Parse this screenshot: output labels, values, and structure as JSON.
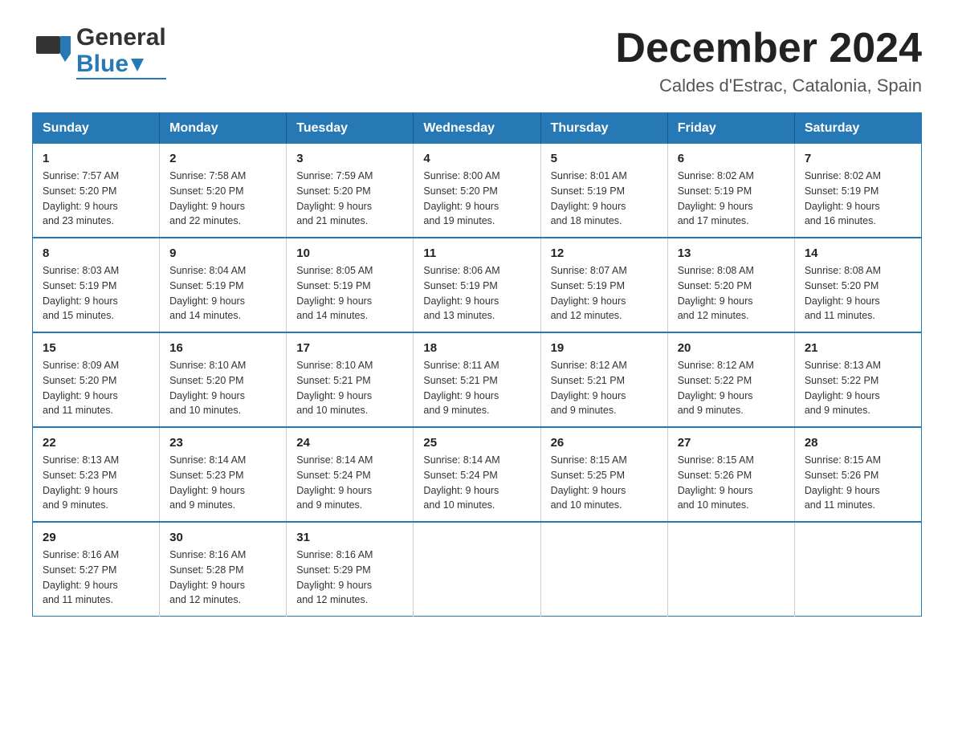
{
  "header": {
    "logo": {
      "general": "General",
      "blue": "Blue"
    },
    "title": "December 2024",
    "subtitle": "Caldes d'Estrac, Catalonia, Spain"
  },
  "calendar": {
    "days": [
      "Sunday",
      "Monday",
      "Tuesday",
      "Wednesday",
      "Thursday",
      "Friday",
      "Saturday"
    ],
    "weeks": [
      [
        {
          "num": "1",
          "sunrise": "7:57 AM",
          "sunset": "5:20 PM",
          "daylight": "9 hours and 23 minutes."
        },
        {
          "num": "2",
          "sunrise": "7:58 AM",
          "sunset": "5:20 PM",
          "daylight": "9 hours and 22 minutes."
        },
        {
          "num": "3",
          "sunrise": "7:59 AM",
          "sunset": "5:20 PM",
          "daylight": "9 hours and 21 minutes."
        },
        {
          "num": "4",
          "sunrise": "8:00 AM",
          "sunset": "5:20 PM",
          "daylight": "9 hours and 19 minutes."
        },
        {
          "num": "5",
          "sunrise": "8:01 AM",
          "sunset": "5:19 PM",
          "daylight": "9 hours and 18 minutes."
        },
        {
          "num": "6",
          "sunrise": "8:02 AM",
          "sunset": "5:19 PM",
          "daylight": "9 hours and 17 minutes."
        },
        {
          "num": "7",
          "sunrise": "8:02 AM",
          "sunset": "5:19 PM",
          "daylight": "9 hours and 16 minutes."
        }
      ],
      [
        {
          "num": "8",
          "sunrise": "8:03 AM",
          "sunset": "5:19 PM",
          "daylight": "9 hours and 15 minutes."
        },
        {
          "num": "9",
          "sunrise": "8:04 AM",
          "sunset": "5:19 PM",
          "daylight": "9 hours and 14 minutes."
        },
        {
          "num": "10",
          "sunrise": "8:05 AM",
          "sunset": "5:19 PM",
          "daylight": "9 hours and 14 minutes."
        },
        {
          "num": "11",
          "sunrise": "8:06 AM",
          "sunset": "5:19 PM",
          "daylight": "9 hours and 13 minutes."
        },
        {
          "num": "12",
          "sunrise": "8:07 AM",
          "sunset": "5:19 PM",
          "daylight": "9 hours and 12 minutes."
        },
        {
          "num": "13",
          "sunrise": "8:08 AM",
          "sunset": "5:20 PM",
          "daylight": "9 hours and 12 minutes."
        },
        {
          "num": "14",
          "sunrise": "8:08 AM",
          "sunset": "5:20 PM",
          "daylight": "9 hours and 11 minutes."
        }
      ],
      [
        {
          "num": "15",
          "sunrise": "8:09 AM",
          "sunset": "5:20 PM",
          "daylight": "9 hours and 11 minutes."
        },
        {
          "num": "16",
          "sunrise": "8:10 AM",
          "sunset": "5:20 PM",
          "daylight": "9 hours and 10 minutes."
        },
        {
          "num": "17",
          "sunrise": "8:10 AM",
          "sunset": "5:21 PM",
          "daylight": "9 hours and 10 minutes."
        },
        {
          "num": "18",
          "sunrise": "8:11 AM",
          "sunset": "5:21 PM",
          "daylight": "9 hours and 9 minutes."
        },
        {
          "num": "19",
          "sunrise": "8:12 AM",
          "sunset": "5:21 PM",
          "daylight": "9 hours and 9 minutes."
        },
        {
          "num": "20",
          "sunrise": "8:12 AM",
          "sunset": "5:22 PM",
          "daylight": "9 hours and 9 minutes."
        },
        {
          "num": "21",
          "sunrise": "8:13 AM",
          "sunset": "5:22 PM",
          "daylight": "9 hours and 9 minutes."
        }
      ],
      [
        {
          "num": "22",
          "sunrise": "8:13 AM",
          "sunset": "5:23 PM",
          "daylight": "9 hours and 9 minutes."
        },
        {
          "num": "23",
          "sunrise": "8:14 AM",
          "sunset": "5:23 PM",
          "daylight": "9 hours and 9 minutes."
        },
        {
          "num": "24",
          "sunrise": "8:14 AM",
          "sunset": "5:24 PM",
          "daylight": "9 hours and 9 minutes."
        },
        {
          "num": "25",
          "sunrise": "8:14 AM",
          "sunset": "5:24 PM",
          "daylight": "9 hours and 10 minutes."
        },
        {
          "num": "26",
          "sunrise": "8:15 AM",
          "sunset": "5:25 PM",
          "daylight": "9 hours and 10 minutes."
        },
        {
          "num": "27",
          "sunrise": "8:15 AM",
          "sunset": "5:26 PM",
          "daylight": "9 hours and 10 minutes."
        },
        {
          "num": "28",
          "sunrise": "8:15 AM",
          "sunset": "5:26 PM",
          "daylight": "9 hours and 11 minutes."
        }
      ],
      [
        {
          "num": "29",
          "sunrise": "8:16 AM",
          "sunset": "5:27 PM",
          "daylight": "9 hours and 11 minutes."
        },
        {
          "num": "30",
          "sunrise": "8:16 AM",
          "sunset": "5:28 PM",
          "daylight": "9 hours and 12 minutes."
        },
        {
          "num": "31",
          "sunrise": "8:16 AM",
          "sunset": "5:29 PM",
          "daylight": "9 hours and 12 minutes."
        },
        null,
        null,
        null,
        null
      ]
    ]
  },
  "labels": {
    "sunrise": "Sunrise:",
    "sunset": "Sunset:",
    "daylight": "Daylight:"
  }
}
